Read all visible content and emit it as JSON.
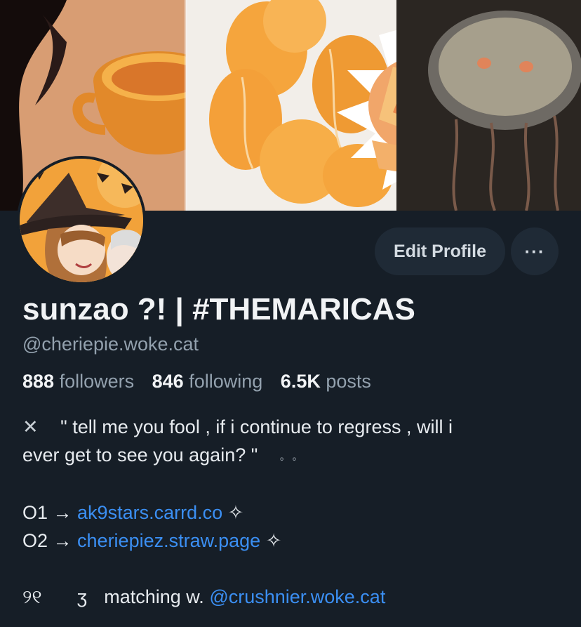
{
  "profile": {
    "display_name": "sunzao ?! | #THEMARICAS",
    "handle": "@cheriepie.woke.cat",
    "stats": {
      "followers_count": "888",
      "followers_label": "followers",
      "following_count": "846",
      "following_label": "following",
      "posts_count": "6.5K",
      "posts_label": "posts"
    },
    "actions": {
      "edit_label": "Edit Profile",
      "more_label": "···"
    },
    "bio": {
      "line1_icon": "✕",
      "line1_text": "\"  tell me you fool , if i continue to regress , will i",
      "line2_text": "ever get to see you again?  \"",
      "line2_deco": "。  。",
      "link1_prefix": "O1 → ",
      "link1_text": "ak9stars.carrd.co",
      "link1_suffix": " ✧",
      "link2_prefix": "O2 → ",
      "link2_text": "cheriepiez.straw.page",
      "link2_suffix": " ✧",
      "match_prefix_left": "୨୧",
      "match_prefix_right": "ʒ",
      "match_text": "matching w. ",
      "match_link": "@crushnier.woke.cat"
    }
  },
  "colors": {
    "background": "#161e27",
    "button_bg": "#1f2a36",
    "link": "#3b8ff3",
    "muted": "#93a1ae"
  }
}
